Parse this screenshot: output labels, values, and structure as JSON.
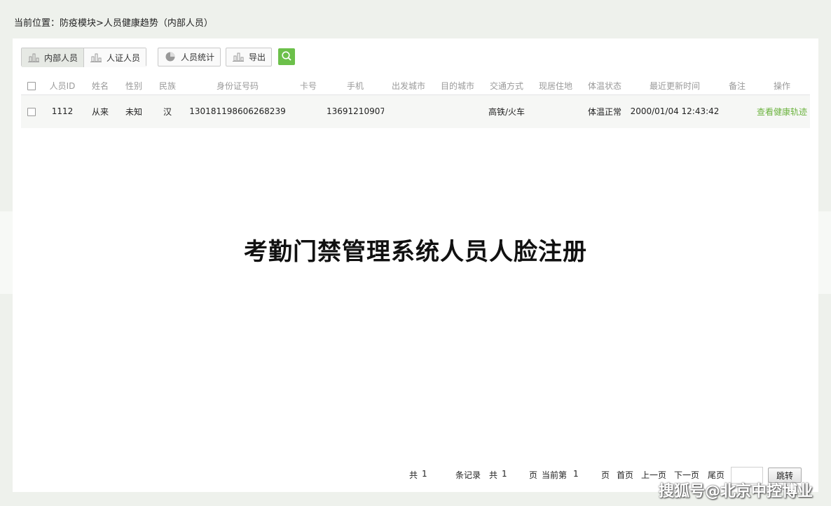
{
  "breadcrumb": "当前位置：防疫模块>人员健康趋势（内部人员）",
  "toolbar": {
    "internal_staff": "内部人员",
    "id_staff": "人证人员",
    "staff_stats": "人员统计",
    "export": "导出"
  },
  "table": {
    "headers": [
      "人员ID",
      "姓名",
      "性别",
      "民族",
      "身份证号码",
      "卡号",
      "手机",
      "出发城市",
      "目的城市",
      "交通方式",
      "现居住地",
      "体温状态",
      "最近更新时间",
      "备注",
      "操作"
    ],
    "rows": [
      {
        "id": "1112",
        "name": "从来",
        "gender": "未知",
        "ethnicity": "汉",
        "id_number": "130181198606268239",
        "card_no": "",
        "phone": "13691210907",
        "from_city": "",
        "to_city": "",
        "transport": "高铁/火车",
        "residence": "",
        "temp_status": "体温正常",
        "updated": "2000/01/04 12:43:42",
        "remark": "",
        "action": "查看健康轨迹"
      }
    ]
  },
  "overlay_title": "考勤门禁管理系统人员人脸注册",
  "pager": {
    "total_prefix": "共",
    "total_records": "1",
    "records_label": "条记录",
    "pages_prefix": "共",
    "total_pages": "1",
    "pages_label": "页",
    "current_prefix": "当前第",
    "current_page": "1",
    "current_suffix": "页",
    "first": "首页",
    "prev": "上一页",
    "next": "下一页",
    "last": "尾页",
    "jump_value": "",
    "jump": "跳转"
  },
  "watermark": "搜狐号@北京中控博业",
  "colors": {
    "accent": "#6cc04a",
    "link": "#6cb33f",
    "background": "#eef1ec"
  }
}
